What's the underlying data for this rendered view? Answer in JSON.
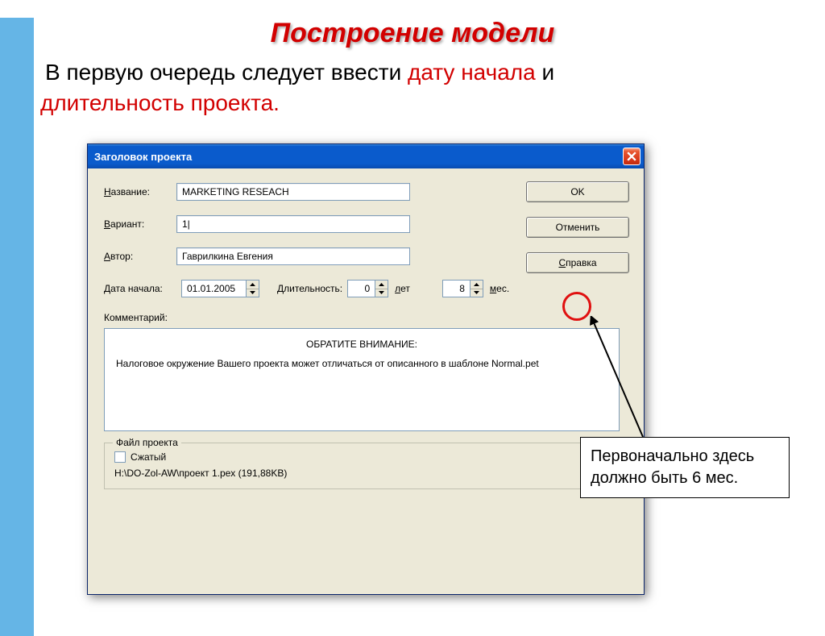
{
  "slide": {
    "title": "Построение модели",
    "sub_prefix": "В",
    "sub_text_1": "первую очередь следует ввести ",
    "sub_red_1": "дату начала",
    "sub_text_2": " и ",
    "sub_red_2": "длительность проекта",
    "sub_dot": "."
  },
  "dialog": {
    "title": "Заголовок проекта",
    "labels": {
      "name_pre": "Н",
      "name_rest": "азвание:",
      "variant_pre": "В",
      "variant_rest": "ариант:",
      "author_pre": "А",
      "author_rest": "втор:",
      "date_pre": "Д",
      "date_rest": "ата начала:",
      "dur_pre": "Д",
      "dur_rest": "лительность:",
      "years_pre": "л",
      "years_rest": "ет",
      "months_pre": "м",
      "months_rest": "ес.",
      "comment_pre": "К",
      "comment_rest": "омментарий:",
      "group_title": "Файл проекта",
      "compressed_pre": "С",
      "compressed_rest": "жатый"
    },
    "values": {
      "name": "MARKETING RESEACH",
      "variant": "1|",
      "author": "Гаврилкина Евгения",
      "date": "01.01.2005",
      "dur_years": "0",
      "dur_months": "8",
      "path": "H:\\DO-Zol-AW\\проект 1.pex (191,88KB)"
    },
    "comment": {
      "head": "ОБРАТИТЕ ВНИМАНИЕ:",
      "body": "Налоговое окружение Вашего проекта может отличаться от описанного в шаблоне Normal.pet"
    },
    "buttons": {
      "ok": "OK",
      "cancel": "Отменить",
      "help_pre": "С",
      "help_rest": "правка"
    }
  },
  "callout": {
    "text": "Первоначально здесь должно быть 6 мес."
  }
}
